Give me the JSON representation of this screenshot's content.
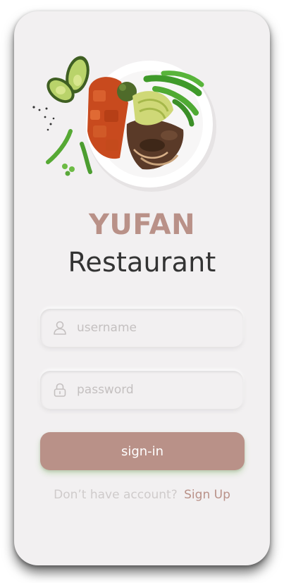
{
  "app": {
    "brand_top": "YUFAN",
    "brand_bottom": "Restaurant"
  },
  "form": {
    "username": {
      "placeholder": "username",
      "icon": "user-icon"
    },
    "password": {
      "placeholder": "password",
      "icon": "lock-icon"
    },
    "signin_label": "sign-in"
  },
  "footer": {
    "question": "Don’t have account?",
    "signup_label": "Sign Up"
  },
  "colors": {
    "accent": "#b99188",
    "text_dark": "#333333",
    "card_bg": "#f2f0f1",
    "muted": "#cfcbcb"
  }
}
